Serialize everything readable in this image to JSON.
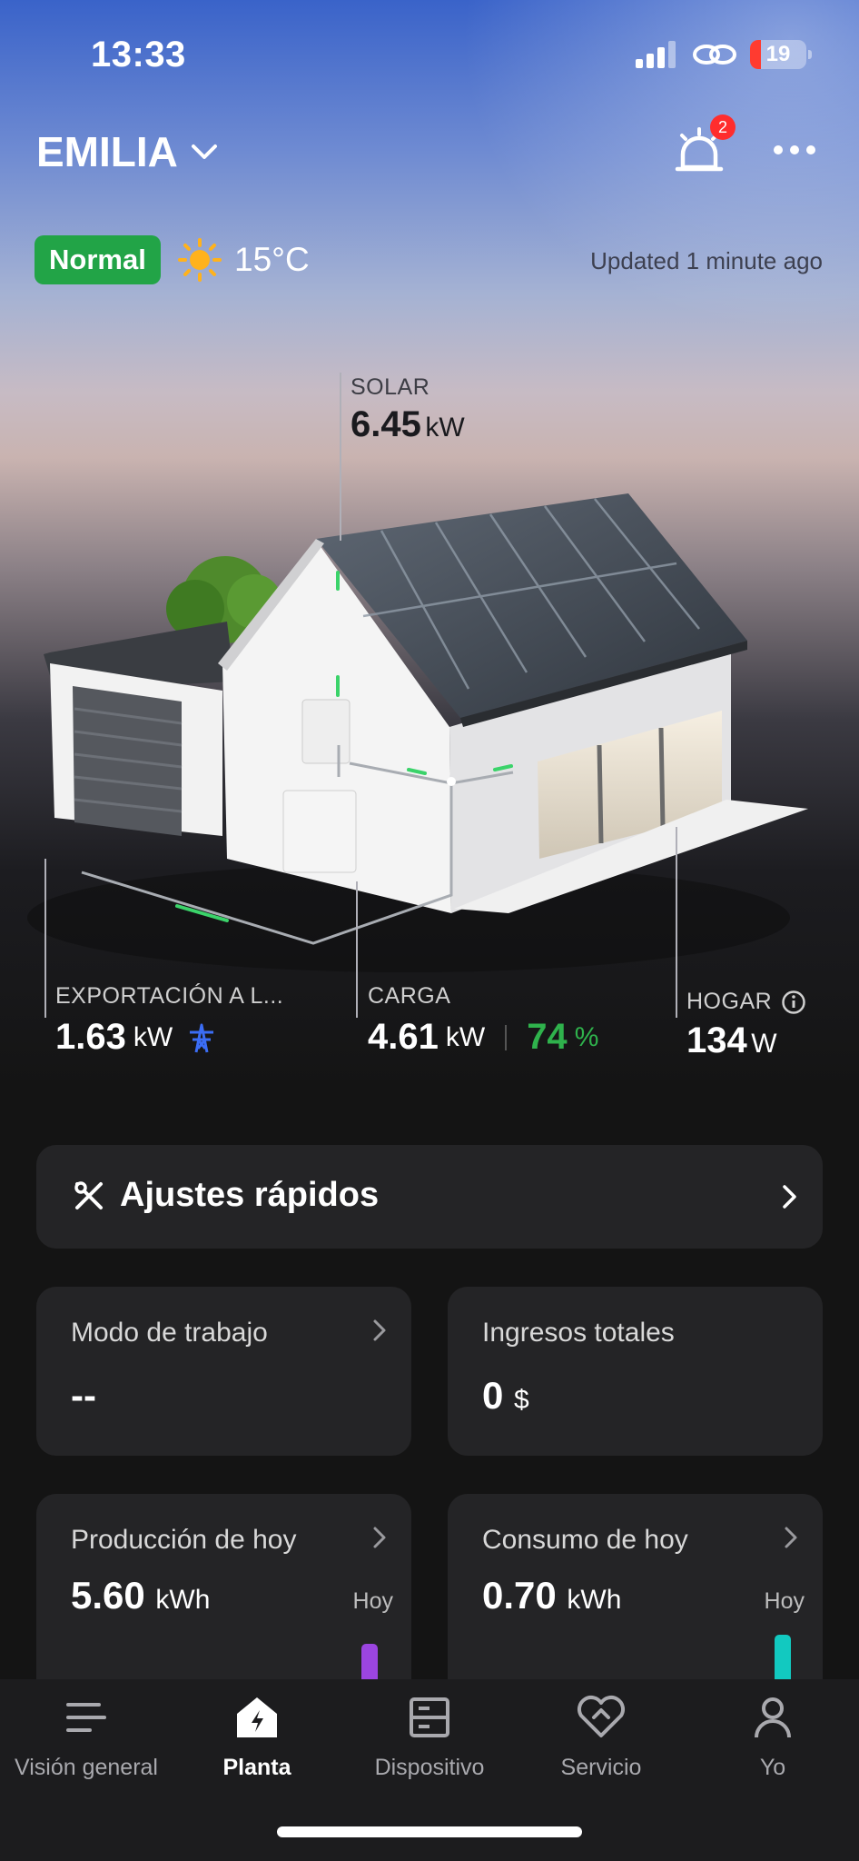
{
  "status_bar": {
    "time": "13:33",
    "battery": "19"
  },
  "header": {
    "plant_name": "EMILIA",
    "notifications_count": "2"
  },
  "status": {
    "badge": "Normal",
    "temperature": "15°C",
    "updated": "Updated 1 minute ago"
  },
  "flow": {
    "solar": {
      "label": "SOLAR",
      "value": "6.45",
      "unit": "kW"
    },
    "export": {
      "label": "EXPORTACIÓN A L...",
      "value": "1.63",
      "unit": "kW"
    },
    "charge": {
      "label": "CARGA",
      "value": "4.61",
      "unit": "kW",
      "soc": "74",
      "soc_unit": "%"
    },
    "home": {
      "label": "HOGAR",
      "value": "134",
      "unit": "W"
    }
  },
  "quick_settings": {
    "label": "Ajustes rápidos"
  },
  "cards": {
    "work_mode": {
      "title": "Modo de trabajo",
      "value": "--"
    },
    "total_income": {
      "title": "Ingresos totales",
      "value": "0",
      "unit": "$"
    },
    "production_today": {
      "title": "Producción de hoy",
      "value": "5.60",
      "unit": "kWh",
      "bar_label": "Hoy"
    },
    "consumption_today": {
      "title": "Consumo de hoy",
      "value": "0.70",
      "unit": "kWh",
      "bar_label": "Hoy"
    }
  },
  "tabbar": {
    "overview": "Visión general",
    "plant": "Planta",
    "device": "Dispositivo",
    "service": "Servicio",
    "me": "Yo"
  },
  "colors": {
    "accent_green": "#22a447",
    "soc_green": "#2fb24c",
    "production_bar": "#9b45e0",
    "consumption_bar": "#12c9c0"
  }
}
